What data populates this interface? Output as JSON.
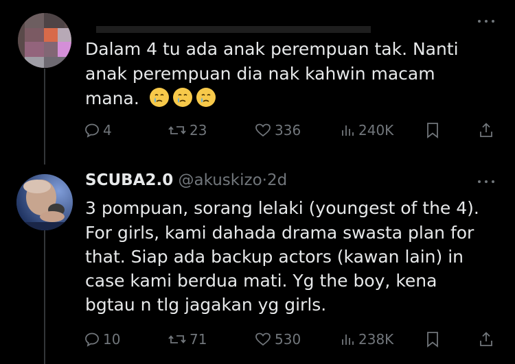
{
  "tweet1": {
    "text_lines": [
      "Dalam 4 tu ada anak perempuan tak. Nanti",
      "anak perempuan dia nak kahwin macam",
      "mana."
    ],
    "emojis": [
      "crying-face",
      "crying-face",
      "crying-face"
    ],
    "stats": {
      "replies": "4",
      "reposts": "23",
      "likes": "336",
      "views": "240K"
    }
  },
  "tweet2": {
    "display_name": "SCUBA2.0",
    "handle": "@akuskizo",
    "separator": "·",
    "time": "2d",
    "text_lines": [
      "3 pompuan, sorang lelaki (youngest of the 4).",
      "For girls, kami dahada drama swasta plan for",
      "that. Siap ada backup actors (kawan lain) in",
      "case kami berdua mati. Yg the boy, kena",
      "bgtau n tlg jagakan yg girls."
    ],
    "stats": {
      "replies": "10",
      "reposts": "71",
      "likes": "530",
      "views": "238K"
    }
  },
  "colors": {
    "background": "#000000",
    "text": "#e7e9ea",
    "muted": "#71767b",
    "divider": "#333639"
  }
}
